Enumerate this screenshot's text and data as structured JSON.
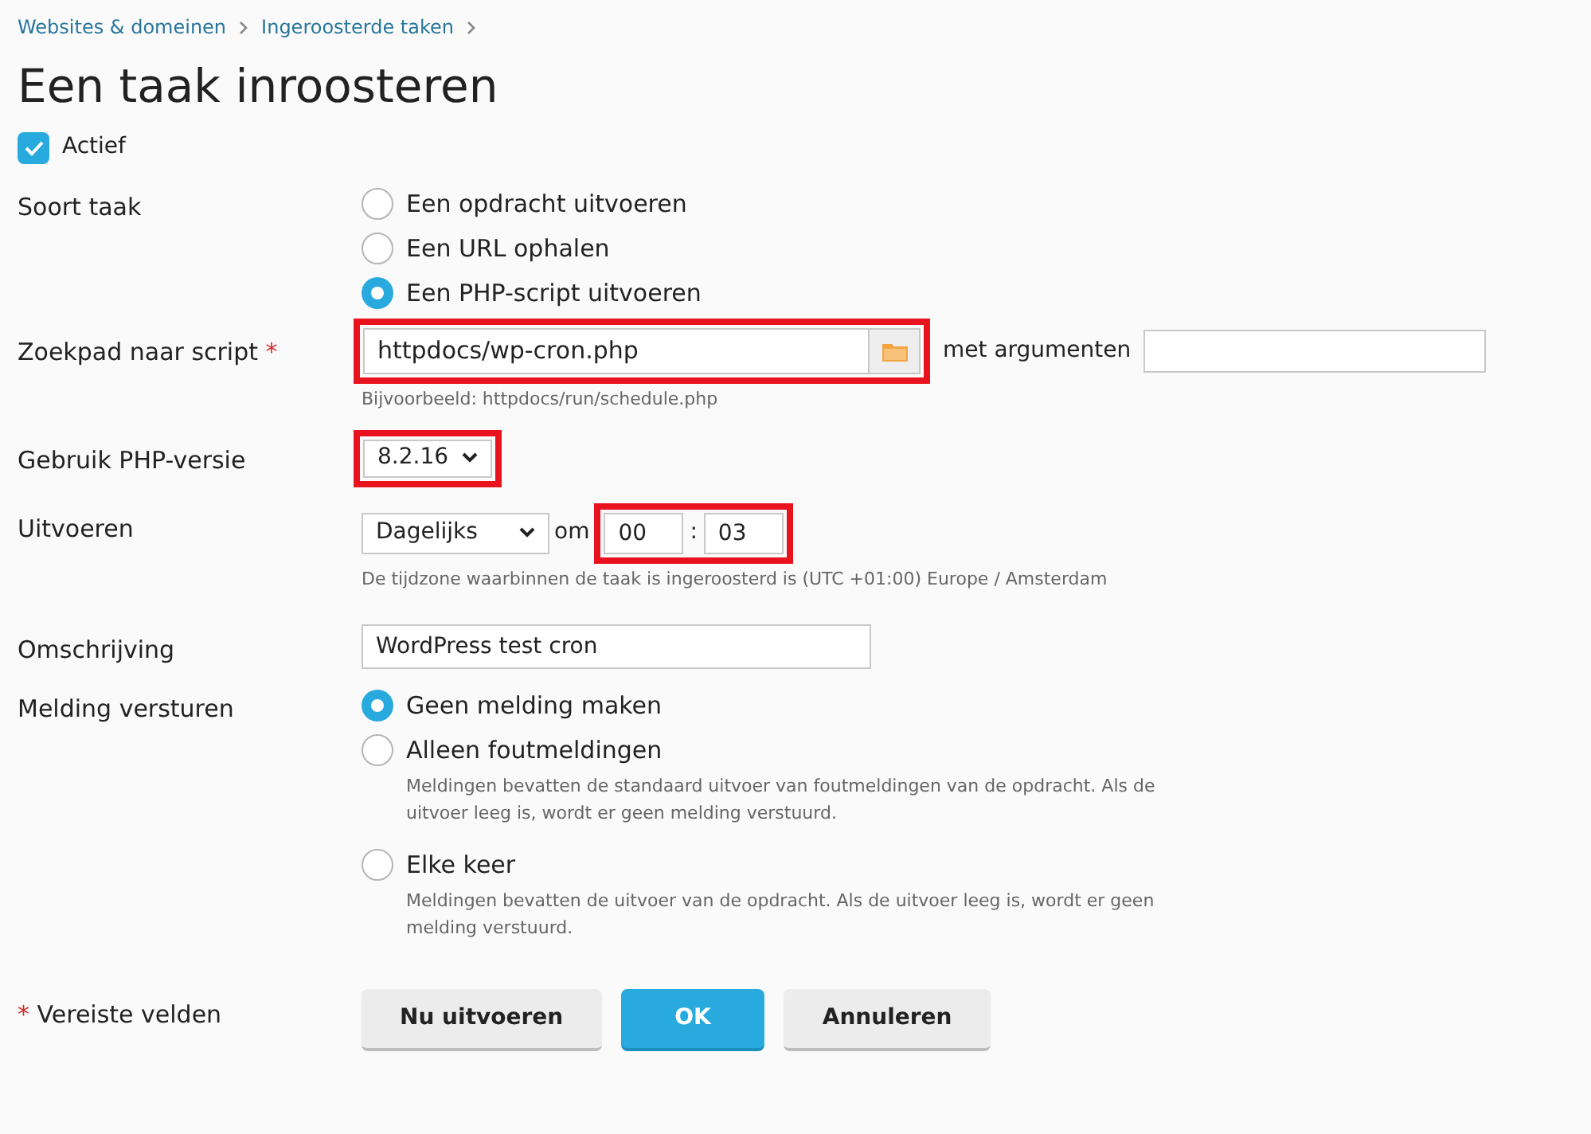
{
  "breadcrumbs": [
    "Websites & domeinen",
    "Ingeroosterde taken"
  ],
  "title": "Een taak inroosteren",
  "active": {
    "label": "Actief",
    "checked": true
  },
  "task_type": {
    "label": "Soort taak",
    "options": [
      {
        "label": "Een opdracht uitvoeren",
        "selected": false
      },
      {
        "label": "Een URL ophalen",
        "selected": false
      },
      {
        "label": "Een PHP-script uitvoeren",
        "selected": true
      }
    ]
  },
  "script_path": {
    "label": "Zoekpad naar script",
    "required_mark": "*",
    "value": "httpdocs/wp-cron.php",
    "highlighted": true,
    "args_label": "met argumenten",
    "hint": "Bijvoorbeeld: httpdocs/run/schedule.php"
  },
  "php_version": {
    "label": "Gebruik PHP-versie",
    "value": "8.2.16",
    "highlighted": true
  },
  "run": {
    "label": "Uitvoeren",
    "frequency": "Dagelijks",
    "at_label": "om",
    "hour": "00",
    "separator": ":",
    "minute": "03",
    "highlighted": true,
    "hint": "De tijdzone waarbinnen de taak is ingeroosterd is (UTC +01:00) Europe / Amsterdam"
  },
  "description": {
    "label": "Omschrijving",
    "value": "WordPress test cron"
  },
  "notification": {
    "label": "Melding versturen",
    "options": [
      {
        "label": "Geen melding maken",
        "selected": true
      },
      {
        "label": "Alleen foutmeldingen",
        "selected": false,
        "hint": "Meldingen bevatten de standaard uitvoer van foutmeldingen van de opdracht. Als de uitvoer leeg is, wordt er geen melding verstuurd."
      },
      {
        "label": "Elke keer",
        "selected": false,
        "hint": "Meldingen bevatten de uitvoer van de opdracht. Als de uitvoer leeg is, wordt er geen melding verstuurd."
      }
    ]
  },
  "required_note": {
    "mark": "*",
    "text": "Vereiste velden"
  },
  "buttons": [
    {
      "label": "Nu uitvoeren",
      "kind": "secondary"
    },
    {
      "label": "OK",
      "kind": "primary"
    },
    {
      "label": "Annuleren",
      "kind": "secondary"
    }
  ]
}
